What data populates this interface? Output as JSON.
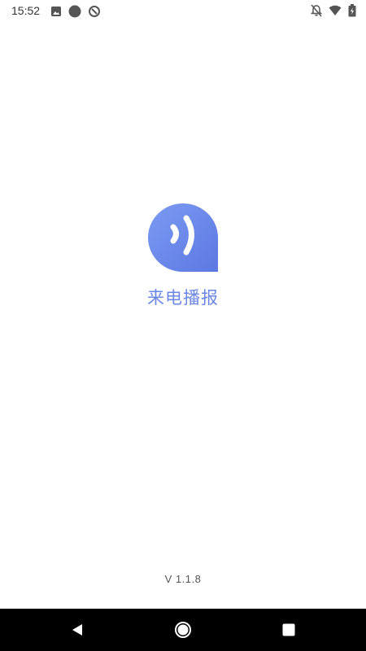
{
  "status_bar": {
    "time": "15:52",
    "left_icons": [
      "image-icon",
      "circle-icon",
      "sync-icon"
    ],
    "right_icons": [
      "notifications-off-icon",
      "wifi-icon",
      "battery-icon"
    ]
  },
  "app": {
    "name": "来电播报",
    "version": "V 1.1.8",
    "logo_icon": "sound-wave-bubble-icon",
    "logo_color": "#6A86E6",
    "name_color": "#6A86E6"
  },
  "nav_bar": {
    "buttons": [
      "back-icon",
      "home-icon",
      "recents-icon"
    ]
  }
}
